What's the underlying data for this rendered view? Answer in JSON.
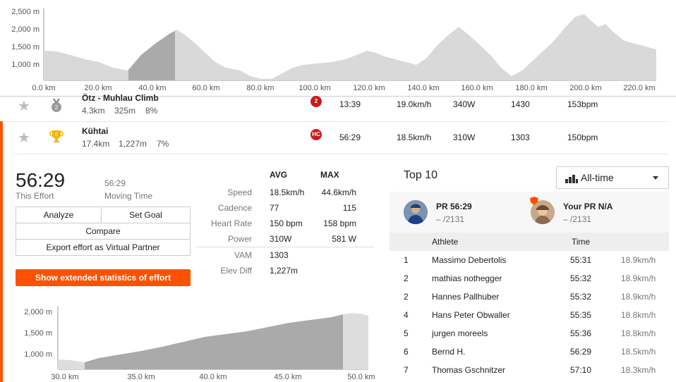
{
  "top_chart": {
    "y_ticks": [
      "2,500 m",
      "2,000 m",
      "1,500 m",
      "1,000 m"
    ],
    "x_ticks": [
      "0.0 km",
      "20.0 km",
      "40.0 km",
      "60.0 km",
      "80.0 km",
      "100.0 km",
      "120.0 km",
      "140.0 km",
      "160.0 km",
      "180.0 km",
      "200.0 km",
      "220.0 km"
    ]
  },
  "segments": [
    {
      "name": "Ötz - Muhlau Climb",
      "distance": "4.3km",
      "elevation": "325m",
      "grade": "8%",
      "medal": "2",
      "category": "2",
      "time": "13:39",
      "speed": "19.0km/h",
      "power": "340W",
      "vam": "1430",
      "hr": "153bpm"
    },
    {
      "name": "Kühtai",
      "distance": "17.4km",
      "elevation": "1,227m",
      "grade": "7%",
      "medal": "6",
      "category": "HC",
      "time": "56:29",
      "speed": "18.5km/h",
      "power": "310W",
      "vam": "1303",
      "hr": "150bpm"
    }
  ],
  "effort": {
    "elapsed_time": "56:29",
    "elapsed_label": "This Effort",
    "moving_time": "56:29",
    "moving_label": "Moving Time",
    "buttons": {
      "analyze": "Analyze",
      "set_goal": "Set Goal",
      "compare": "Compare",
      "export": "Export effort as Virtual Partner",
      "extended": "Show extended statistics of effort"
    },
    "stats_headers": {
      "avg": "AVG",
      "max": "MAX"
    },
    "stats": [
      {
        "label": "Speed",
        "avg": "18.5km/h",
        "max": "44.6km/h"
      },
      {
        "label": "Cadence",
        "avg": "77",
        "max": "115"
      },
      {
        "label": "Heart Rate",
        "avg": "150 bpm",
        "max": "158 bpm"
      },
      {
        "label": "Power",
        "avg": "310W",
        "max": "581 W"
      },
      {
        "label": "VAM",
        "avg": "1303",
        "max": ""
      },
      {
        "label": "Elev Diff",
        "avg": "1,227m",
        "max": ""
      }
    ]
  },
  "effort_chart": {
    "y_ticks": [
      "2,000 m",
      "1,500 m",
      "1,000 m"
    ],
    "x_ticks": [
      "30.0 km",
      "35.0 km",
      "40.0 km",
      "45.0 km",
      "50.0 km"
    ]
  },
  "top10": {
    "title": "Top 10",
    "filter_label": "All-time",
    "pr": {
      "label": "PR 56:29",
      "rank": "– /2131"
    },
    "your_pr": {
      "label": "Your PR N/A",
      "rank": "– /2131"
    },
    "headers": {
      "athlete": "Athlete",
      "time": "Time"
    },
    "rows": [
      {
        "rank": "1",
        "athlete": "Massimo Debertolis",
        "time": "55:31",
        "speed": "18.9km/h"
      },
      {
        "rank": "2",
        "athlete": "mathias nothegger",
        "time": "55:32",
        "speed": "18.9km/h"
      },
      {
        "rank": "2",
        "athlete": "Hannes Pallhuber",
        "time": "55:32",
        "speed": "18.9km/h"
      },
      {
        "rank": "4",
        "athlete": "Hans Peter Obwaller",
        "time": "55:35",
        "speed": "18.8km/h"
      },
      {
        "rank": "5",
        "athlete": "jurgen moreels",
        "time": "55:36",
        "speed": "18.8km/h"
      },
      {
        "rank": "6",
        "athlete": "Bernd H.",
        "time": "56:29",
        "speed": "18.5km/h"
      },
      {
        "rank": "7",
        "athlete": "Thomas Gschnitzer",
        "time": "57:10",
        "speed": "18.3km/h"
      }
    ]
  },
  "colors": {
    "accent": "#fc5200",
    "hc_badge": "#cc1b1b",
    "gold": "#f5b400",
    "silver": "#9a9a9a"
  }
}
